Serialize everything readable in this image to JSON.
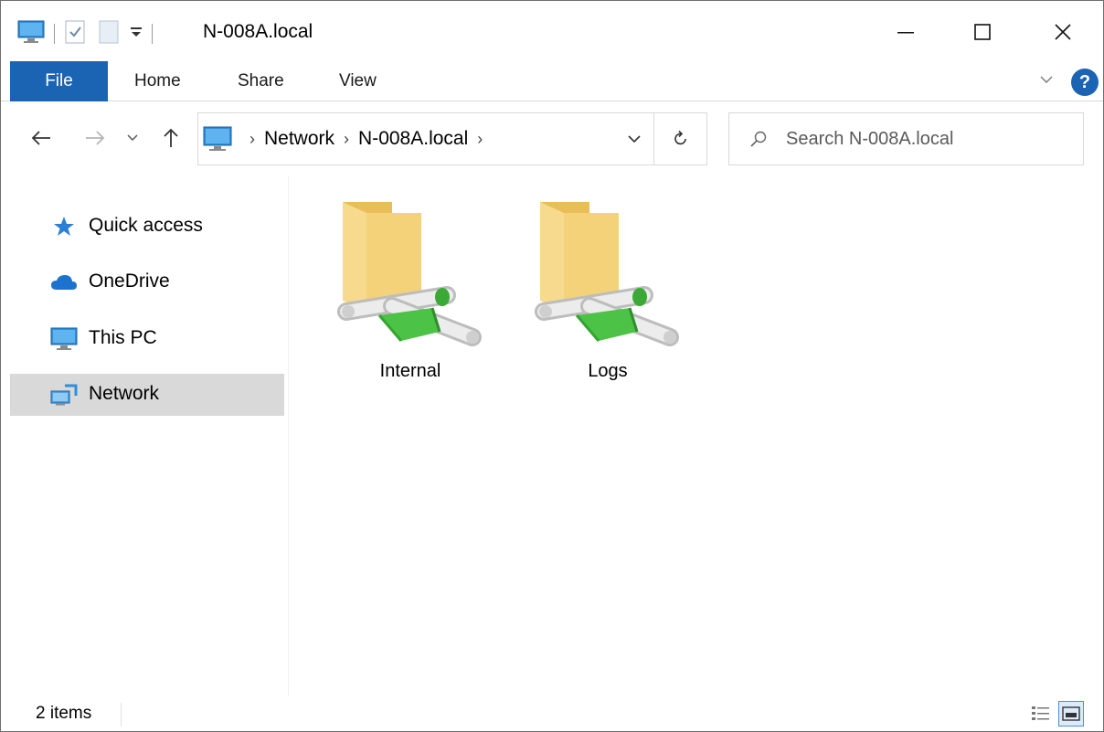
{
  "window": {
    "title": "N-008A.local"
  },
  "ribbon": {
    "tabs": [
      {
        "label": "File"
      },
      {
        "label": "Home"
      },
      {
        "label": "Share"
      },
      {
        "label": "View"
      }
    ],
    "help_label": "?"
  },
  "address": {
    "crumbs": [
      "Network",
      "N-008A.local"
    ],
    "separator": "›"
  },
  "search": {
    "placeholder": "Search N-008A.local"
  },
  "navpane": {
    "items": [
      {
        "label": "Quick access",
        "icon": "star-icon"
      },
      {
        "label": "OneDrive",
        "icon": "cloud-icon"
      },
      {
        "label": "This PC",
        "icon": "monitor-icon"
      },
      {
        "label": "Network",
        "icon": "network-icon",
        "selected": true
      }
    ]
  },
  "content": {
    "items": [
      {
        "name": "Internal",
        "icon": "network-share-folder-icon"
      },
      {
        "name": "Logs",
        "icon": "network-share-folder-icon"
      }
    ]
  },
  "status": {
    "item_count": "2 items"
  },
  "colors": {
    "accent": "#1b63b3",
    "selected_nav": "#d9d9d9",
    "folder": "#f4d27a",
    "pipe": "#4cc247"
  }
}
